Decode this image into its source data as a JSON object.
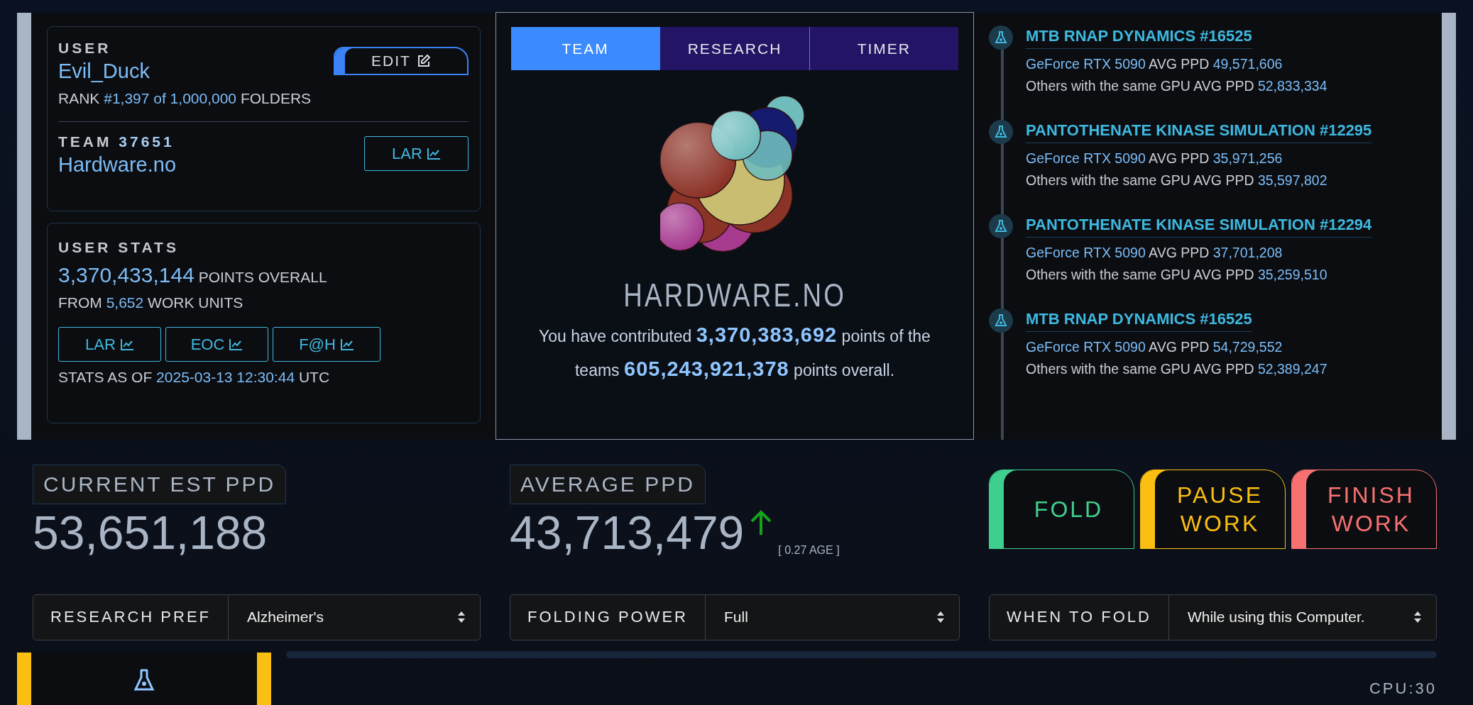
{
  "user_card": {
    "label": "USER",
    "name": "Evil_Duck",
    "edit_button": "EDIT",
    "rank": [
      {
        "text": "RANK",
        "highlight": false
      },
      {
        "text": "#1,397 of 1,000,000",
        "highlight": true
      },
      {
        "text": "FOLDERS",
        "highlight": false
      }
    ],
    "team_label": "TEAM",
    "team_number": "37651",
    "team_name": "Hardware.no",
    "team_button": "LAR"
  },
  "stats_card": {
    "label": "USER STATS",
    "points": "3,370,433,144",
    "points_suffix": "POINTS OVERALL",
    "units": [
      {
        "text": "FROM",
        "highlight": false
      },
      {
        "text": "5,652",
        "highlight": true
      },
      {
        "text": "WORK UNITS",
        "highlight": false
      }
    ],
    "buttons": [
      "LAR",
      "EOC",
      "F@H"
    ],
    "as_of": [
      {
        "text": "STATS AS OF",
        "highlight": false
      },
      {
        "text": "2025-03-13 12:30:44",
        "highlight": true
      },
      {
        "text": "UTC",
        "highlight": false
      }
    ]
  },
  "tabs": [
    {
      "label": "TEAM",
      "selected": true
    },
    {
      "label": "RESEARCH",
      "selected": false
    },
    {
      "label": "TIMER",
      "selected": false
    }
  ],
  "team_panel": {
    "name": "HARDWARE.NO",
    "contribution": [
      {
        "text": "You have contributed",
        "highlight": false
      },
      {
        "text": "3,370,383,692",
        "highlight": true
      },
      {
        "text": "points of the teams",
        "highlight": false
      },
      {
        "text": "605,243,921,378",
        "highlight": true
      },
      {
        "text": "points overall.",
        "highlight": false
      }
    ]
  },
  "timeline": [
    {
      "title": "MTB RNAP DYNAMICS #16525",
      "gpu": "GeForce RTX 5090",
      "avg_label": "AVG PPD",
      "ppd": "49,571,606",
      "others_label": "Others with the same GPU AVG PPD",
      "others_ppd": "52,833,334"
    },
    {
      "title": "PANTOTHENATE KINASE SIMULATION #12295",
      "gpu": "GeForce RTX 5090",
      "avg_label": "AVG PPD",
      "ppd": "35,971,256",
      "others_label": "Others with the same GPU AVG PPD",
      "others_ppd": "35,597,802"
    },
    {
      "title": "PANTOTHENATE KINASE SIMULATION #12294",
      "gpu": "GeForce RTX 5090",
      "avg_label": "AVG PPD",
      "ppd": "37,701,208",
      "others_label": "Others with the same GPU AVG PPD",
      "others_ppd": "35,259,510"
    },
    {
      "title": "MTB RNAP DYNAMICS #16525",
      "gpu": "GeForce RTX 5090",
      "avg_label": "AVG PPD",
      "ppd": "54,729,552",
      "others_label": "Others with the same GPU AVG PPD",
      "others_ppd": "52,389,247"
    }
  ],
  "ppd_current": {
    "label": "CURRENT EST PPD",
    "value": "53,651,188"
  },
  "ppd_average": {
    "label": "AVERAGE PPD",
    "value": "43,713,479",
    "age": "[ 0.27 AGE ]"
  },
  "actions": [
    {
      "label": "FOLD",
      "color": "#3ecf8e"
    },
    {
      "label": "PAUSE WORK",
      "color": "#fbbf12"
    },
    {
      "label": "FINISH WORK",
      "color": "#f87171"
    }
  ],
  "selects": [
    {
      "label": "RESEARCH PREF",
      "value": "Alzheimer's"
    },
    {
      "label": "FOLDING POWER",
      "value": "Full"
    },
    {
      "label": "WHEN TO FOLD",
      "value": "While using this Computer."
    }
  ],
  "bottom": {
    "cpu": "CPU:30"
  }
}
